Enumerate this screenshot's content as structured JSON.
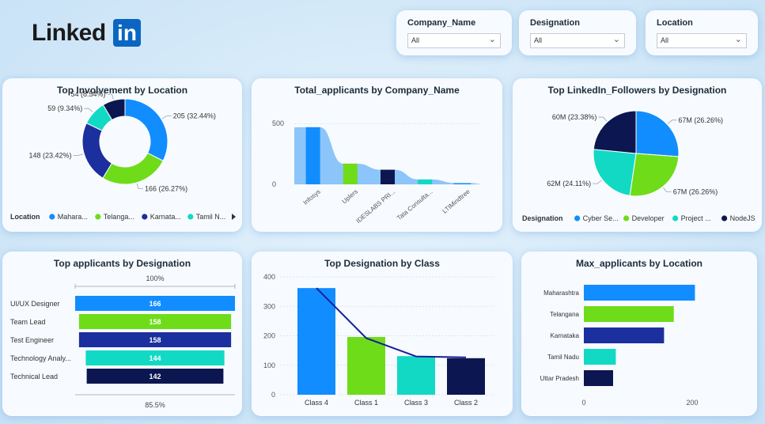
{
  "logo": {
    "text": "Linked",
    "box": "in"
  },
  "slicers": [
    {
      "label": "Company_Name",
      "value": "All"
    },
    {
      "label": "Designation",
      "value": "All"
    },
    {
      "label": "Location",
      "value": "All"
    }
  ],
  "icons": {
    "chevron": "chevron-down-icon",
    "legend_next": "triangle-right-icon"
  },
  "colors": {
    "blue": "#118dff",
    "green": "#6fdc1a",
    "navy": "#1c2f9e",
    "teal": "#12d9c4",
    "darknavy": "#0c1650",
    "lightblue": "#78bbf8"
  },
  "chart_data": [
    {
      "id": "involvement",
      "type": "pie",
      "donut": true,
      "title": "Top Involvement by Location",
      "legend_title": "Location",
      "legend_placement": "bottom",
      "legend": [
        "Mahara...",
        "Telanga...",
        "Karnata...",
        "Tamil N..."
      ],
      "slices": [
        {
          "name": "Maharashtra",
          "value": 205,
          "label": "205 (32.44%)",
          "color": "#118dff"
        },
        {
          "name": "Telangana",
          "value": 166,
          "label": "166 (26.27%)",
          "color": "#6fdc1a"
        },
        {
          "name": "Karnataka",
          "value": 148,
          "label": "148 (23.42%)",
          "color": "#1c2f9e"
        },
        {
          "name": "Tamil Nadu",
          "value": 59,
          "label": "59 (9.34%)",
          "color": "#12d9c4"
        },
        {
          "name": "Uttar Pradesh",
          "value": 54,
          "label": "54 (8.54%)",
          "color": "#0c1650"
        }
      ]
    },
    {
      "id": "total_applicants",
      "type": "bar",
      "title": "Total_applicants by Company_Name",
      "categories": [
        "Infosys",
        "Uplers",
        "IDESLABS PRI...",
        "Tata Consulta...",
        "LTIMindtree"
      ],
      "values": [
        470,
        170,
        120,
        40,
        10
      ],
      "colors": [
        "#118dff",
        "#6fdc1a",
        "#0c1650",
        "#12d9c4",
        "#118dff"
      ],
      "yticks": [
        0,
        500
      ],
      "ylim": [
        0,
        560
      ]
    },
    {
      "id": "followers",
      "type": "pie",
      "title": "Top LinkedIn_Followers by Designation",
      "legend_title": "Designation",
      "legend_placement": "bottom",
      "legend": [
        "Cyber Se...",
        "Developer",
        "Project ...",
        "NodeJS"
      ],
      "slices": [
        {
          "name": "Cyber Security",
          "value": 67,
          "label": "67M (26.26%)",
          "color": "#118dff"
        },
        {
          "name": "Developer",
          "value": 67,
          "label": "67M (26.26%)",
          "color": "#6fdc1a"
        },
        {
          "name": "Project Manager",
          "value": 62,
          "label": "62M (24.11%)",
          "color": "#12d9c4"
        },
        {
          "name": "NodeJS",
          "value": 60,
          "label": "60M (23.38%)",
          "color": "#0c1650"
        }
      ]
    },
    {
      "id": "funnel",
      "type": "bar",
      "title": "Top applicants by Designation",
      "top_label": "100%",
      "bottom_label": "85.5%",
      "categories": [
        "UI/UX Designer",
        "Team Lead",
        "Test Engineer",
        "Technology Analy...",
        "Technical Lead"
      ],
      "values": [
        166,
        158,
        158,
        144,
        142
      ],
      "colors": [
        "#118dff",
        "#6fdc1a",
        "#1c2f9e",
        "#12d9c4",
        "#0c1650"
      ]
    },
    {
      "id": "class",
      "type": "bar",
      "title": "Top Designation by Class",
      "categories": [
        "Class 4",
        "Class 1",
        "Class 3",
        "Class 2"
      ],
      "values": [
        362,
        196,
        131,
        124
      ],
      "line_values": [
        362,
        192,
        130,
        127
      ],
      "colors": [
        "#118dff",
        "#6fdc1a",
        "#12d9c4",
        "#0c1650"
      ],
      "yticks": [
        0,
        100,
        200,
        300,
        400
      ],
      "ylim": [
        0,
        400
      ]
    },
    {
      "id": "max_location",
      "type": "bar",
      "title": "Max_applicants by Location",
      "categories": [
        "Maharashtra",
        "Telangana",
        "Karnataka",
        "Tamil Nadu",
        "Uttar Pradesh"
      ],
      "values": [
        205,
        166,
        148,
        59,
        54
      ],
      "colors": [
        "#118dff",
        "#6fdc1a",
        "#1c2f9e",
        "#12d9c4",
        "#0c1650"
      ],
      "xticks": [
        0,
        200
      ],
      "xlim": [
        0,
        230
      ]
    }
  ]
}
